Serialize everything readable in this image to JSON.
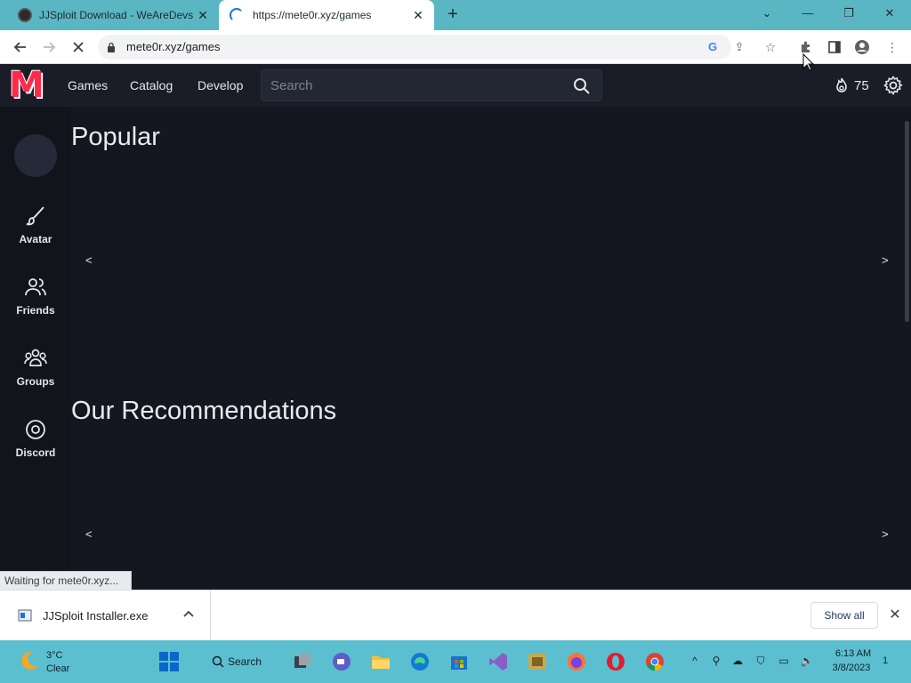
{
  "browser": {
    "tabs": [
      {
        "title": "JJSploit Download - WeAreDevs",
        "active": false
      },
      {
        "title": "https://mete0r.xyz/games",
        "active": true
      }
    ],
    "new_tab": "+",
    "url": "mete0r.xyz/games",
    "window_controls": {
      "tab_list": "⌄",
      "minimize": "—",
      "restore": "❐",
      "close": "✕"
    }
  },
  "site": {
    "logo": "M",
    "nav": [
      "Games",
      "Catalog",
      "Develop"
    ],
    "search_placeholder": "Search",
    "points": "75",
    "sidebar": [
      {
        "label": "Avatar",
        "icon": "brush-icon"
      },
      {
        "label": "Friends",
        "icon": "friends-icon"
      },
      {
        "label": "Groups",
        "icon": "groups-icon"
      },
      {
        "label": "Discord",
        "icon": "discord-icon"
      }
    ],
    "sections": [
      {
        "title": "Popular",
        "prev": "<",
        "next": ">"
      },
      {
        "title": "Our Recommendations",
        "prev": "<",
        "next": ">"
      }
    ]
  },
  "status_text": "Waiting for mete0r.xyz...",
  "download": {
    "file_name": "JJSploit Installer.exe",
    "show_all": "Show all",
    "close": "✕"
  },
  "taskbar": {
    "weather_temp": "3°C",
    "weather_cond": "Clear",
    "search_label": "Search",
    "time": "6:13 AM",
    "date": "3/8/2023",
    "notifications": "1"
  },
  "colors": {
    "accent_red": "#ff2a4a",
    "page_bg": "#141620",
    "header_bg": "#1a1d27",
    "tabstrip": "#5bb6c4",
    "taskbar": "#5bbfd0"
  }
}
